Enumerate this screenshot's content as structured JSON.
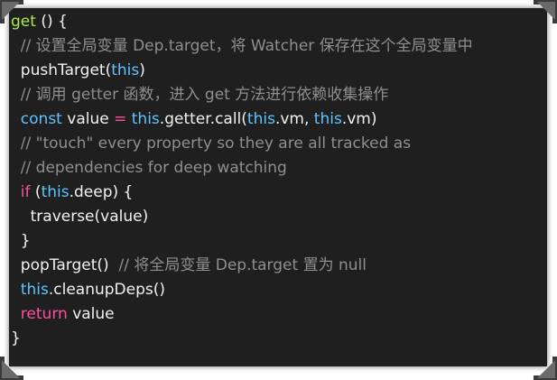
{
  "code_lines": [
    [
      {
        "t": "get",
        "c": "fn"
      },
      {
        "t": " () {",
        "c": "pl"
      }
    ],
    [
      {
        "t": "  // 设置全局变量 Dep.target，将 Watcher 保存在这个全局变量中",
        "c": "cm"
      }
    ],
    [
      {
        "t": "  pushTarget(",
        "c": "pl"
      },
      {
        "t": "this",
        "c": "th"
      },
      {
        "t": ")",
        "c": "pl"
      }
    ],
    [
      {
        "t": "  // 调用 getter 函数，进入 get 方法进行依赖收集操作",
        "c": "cm"
      }
    ],
    [
      {
        "t": "  const",
        "c": "th"
      },
      {
        "t": " value ",
        "c": "pl"
      },
      {
        "t": "=",
        "c": "kw"
      },
      {
        "t": " ",
        "c": "pl"
      },
      {
        "t": "this",
        "c": "th"
      },
      {
        "t": ".getter.call(",
        "c": "pl"
      },
      {
        "t": "this",
        "c": "th"
      },
      {
        "t": ".vm, ",
        "c": "pl"
      },
      {
        "t": "this",
        "c": "th"
      },
      {
        "t": ".vm)",
        "c": "pl"
      }
    ],
    [
      {
        "t": "  // \"touch\" every property so they are all tracked as",
        "c": "cm"
      }
    ],
    [
      {
        "t": "  // dependencies for deep watching",
        "c": "cm"
      }
    ],
    [
      {
        "t": "  if",
        "c": "kw"
      },
      {
        "t": " (",
        "c": "pl"
      },
      {
        "t": "this",
        "c": "th"
      },
      {
        "t": ".deep) {",
        "c": "pl"
      }
    ],
    [
      {
        "t": "    traverse(value)",
        "c": "pl"
      }
    ],
    [
      {
        "t": "  }",
        "c": "pl"
      }
    ],
    [
      {
        "t": "  popTarget()  ",
        "c": "pl"
      },
      {
        "t": "// 将全局变量 Dep.target 置为 null",
        "c": "cm"
      }
    ],
    [
      {
        "t": "  ",
        "c": "pl"
      },
      {
        "t": "this",
        "c": "th"
      },
      {
        "t": ".cleanupDeps()",
        "c": "pl"
      }
    ],
    [
      {
        "t": "  return",
        "c": "kw"
      },
      {
        "t": " value",
        "c": "pl"
      }
    ],
    [
      {
        "t": "}",
        "c": "pl"
      }
    ]
  ],
  "colors": {
    "background": "#1f1f1f",
    "keyword": "#ff4fa3",
    "function": "#aee84a",
    "this_const": "#5fc4ff",
    "comment": "#8f8f8f",
    "plain": "#f2f2f2"
  },
  "decorations": [
    "corner-clip-icon",
    "corner-clip-icon",
    "corner-clip-icon",
    "corner-clip-icon"
  ]
}
